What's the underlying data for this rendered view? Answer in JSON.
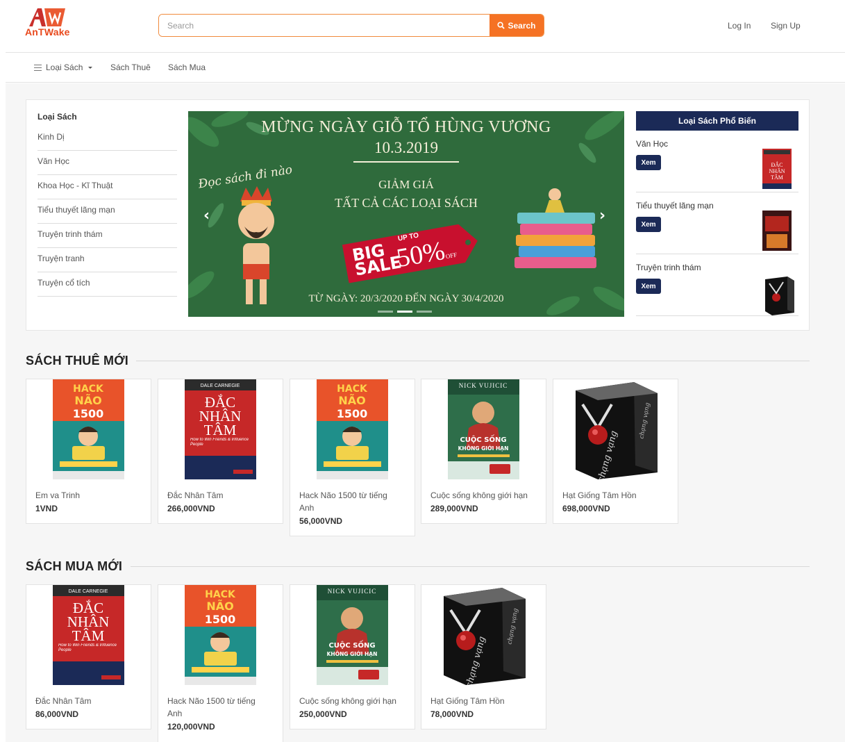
{
  "header": {
    "logo_text": "AnTWake",
    "search_placeholder": "Search",
    "search_button": "Search",
    "login": "Log In",
    "signup": "Sign Up"
  },
  "nav": {
    "categories": "Loại Sách",
    "rent": "Sách Thuê",
    "buy": "Sách Mua"
  },
  "sidebar": {
    "title": "Loại Sách",
    "items": [
      "Kinh Dị",
      "Văn Học",
      "Khoa Học - Kĩ Thuật",
      "Tiểu thuyết lãng mạn",
      "Truyện trinh thám",
      "Truyện tranh",
      "Truyện cổ tích"
    ]
  },
  "banner": {
    "line1": "MỪNG NGÀY GIỖ TỔ HÙNG VƯƠNG",
    "line2": "10.3.2019",
    "line3": "GIẢM GIÁ",
    "line4": "TẤT CẢ CÁC LOẠI SÁCH",
    "script": "Đọc sách đi nào",
    "tag_big": "BIG",
    "tag_sale": "SALE",
    "tag_up": "UP TO",
    "tag_pct": "50%",
    "tag_off": "OFF",
    "dates": "TỪ NGÀY: 20/3/2020 ĐẾN NGÀY 30/4/2020",
    "prev": "‹",
    "next": "›"
  },
  "popular": {
    "title": "Loại Sách Phổ Biến",
    "button": "Xem",
    "items": [
      "Văn Học",
      "Tiểu thuyết lãng mạn",
      "Truyện trinh thám"
    ]
  },
  "rent_section": {
    "title": "SÁCH THUÊ MỚI",
    "books": [
      {
        "name": "Em va Trinh",
        "price": "1VND",
        "cover": "hack-nao"
      },
      {
        "name": "Đắc Nhân Tâm",
        "price": "266,000VND",
        "cover": "dac-nhan-tam"
      },
      {
        "name": "Hack Não 1500 từ tiếng Anh",
        "price": "56,000VND",
        "cover": "hack-nao"
      },
      {
        "name": "Cuộc sống không giới hạn",
        "price": "289,000VND",
        "cover": "cuoc-song"
      },
      {
        "name": "Hạt Giống Tâm Hồn",
        "price": "698,000VND",
        "cover": "chang-vang"
      }
    ]
  },
  "buy_section": {
    "title": "SÁCH MUA MỚI",
    "books": [
      {
        "name": "Đắc Nhân Tâm",
        "price": "86,000VND",
        "cover": "dac-nhan-tam"
      },
      {
        "name": "Hack Não 1500 từ tiếng Anh",
        "price": "120,000VND",
        "cover": "hack-nao"
      },
      {
        "name": "Cuộc sống không giới hạn",
        "price": "250,000VND",
        "cover": "cuoc-song"
      },
      {
        "name": "Hạt Giống Tâm Hồn",
        "price": "78,000VND",
        "cover": "chang-vang"
      }
    ]
  },
  "covers": {
    "hack-nao": {
      "top": "HACK",
      "mid": "NÃO",
      "num": "1500"
    },
    "dac-nhan-tam": {
      "author": "DALE CARNEGIE",
      "l1": "ĐẮC",
      "l2": "NHÂN",
      "l3": "TÂM",
      "sub": "How to Win Friends & Influence People"
    },
    "cuoc-song": {
      "author": "NICK VUJICIC",
      "l1": "CUỘC SỐNG",
      "l2": "KHÔNG GIỚI HẠN"
    },
    "chang-vang": {
      "title": "chạng vạng"
    }
  },
  "colors": {
    "accent": "#f57224",
    "navy": "#1b2a57",
    "banner_green": "#2f6b3c",
    "sale_red": "#c8102e",
    "logo_red": "#e8491d"
  }
}
